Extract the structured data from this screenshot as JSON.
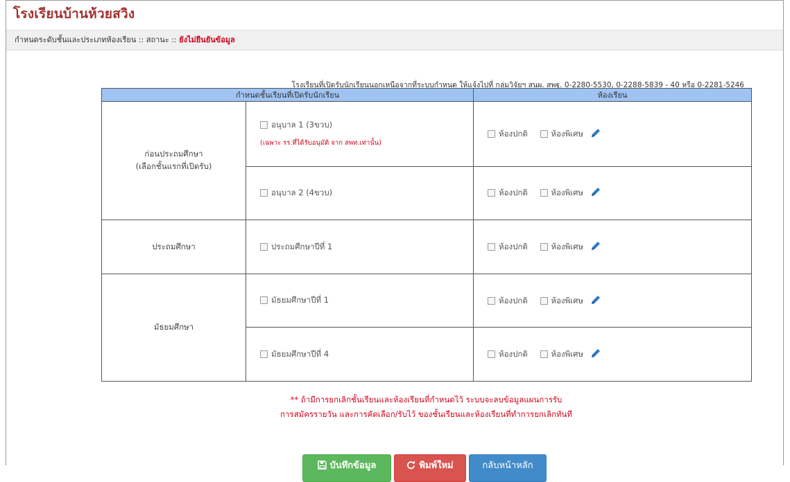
{
  "header": {
    "school_name": "โรงเรียนบ้านห้วยสวิง",
    "breadcrumb": "กำหนดระดับชั้นและประเภทห้องเรียน :: สถานะ :: ",
    "status": "ยังไม่ยืนยันข้อมูล"
  },
  "notice": "โรงเรียนที่เปิดรับนักเรียนนอกเหนือจากที่ระบบกำหนด ให้แจ้งไปที่ กลุ่มวิจัยฯ สนผ. สพฐ. 0-2280-5530, 0-2288-5839 - 40 หรือ 0-2281-5246",
  "table": {
    "col_grades": "กำหนดชั้นเรียนที่เปิดรับนักเรียน",
    "col_rooms": "ห้องเรียน",
    "room_normal": "ห้องปกติ",
    "room_special": "ห้องพิเศษ",
    "levels": {
      "preschool_line1": "ก่อนประถมศึกษา",
      "preschool_line2": "(เลือกชั้นแรกที่เปิดรับ)",
      "primary": "ประถมศึกษา",
      "secondary": "มัธยมศึกษา"
    },
    "grades": {
      "k1": "อนุบาล 1 (3ขวบ)",
      "k1_note": "(เฉพาะ รร.ที่ได้รับอนุมัติ จาก สพท.เท่านั้น)",
      "k2": "อนุบาล 2 (4ขวบ)",
      "p1": "ประถมศึกษาปีที่ 1",
      "m1": "มัธยมศึกษาปีที่ 1",
      "m4": "มัธยมศึกษาปีที่ 4"
    }
  },
  "warning": {
    "line1": "** ถ้ามีการยกเลิกชั้นเรียนและห้องเรียนที่กำหนดไว้ ระบบจะลบข้อมูลแผนการรับ",
    "line2": "การสมัครรายวัน และการคัดเลือก/รับไว้ ของชั้นเรียนและห้องเรียนที่ทำการยกเลิกทันที"
  },
  "buttons": {
    "save": "บันทึกข้อมูล",
    "reset": "พิมพ์ใหม่",
    "home": "กลับหน้าหลัก"
  },
  "colors": {
    "title": "#a1322f",
    "header_bg": "#9fc3f3",
    "alert": "#d0021b",
    "save": "#5cb85c",
    "reset": "#d9534f",
    "home": "#428bca"
  }
}
